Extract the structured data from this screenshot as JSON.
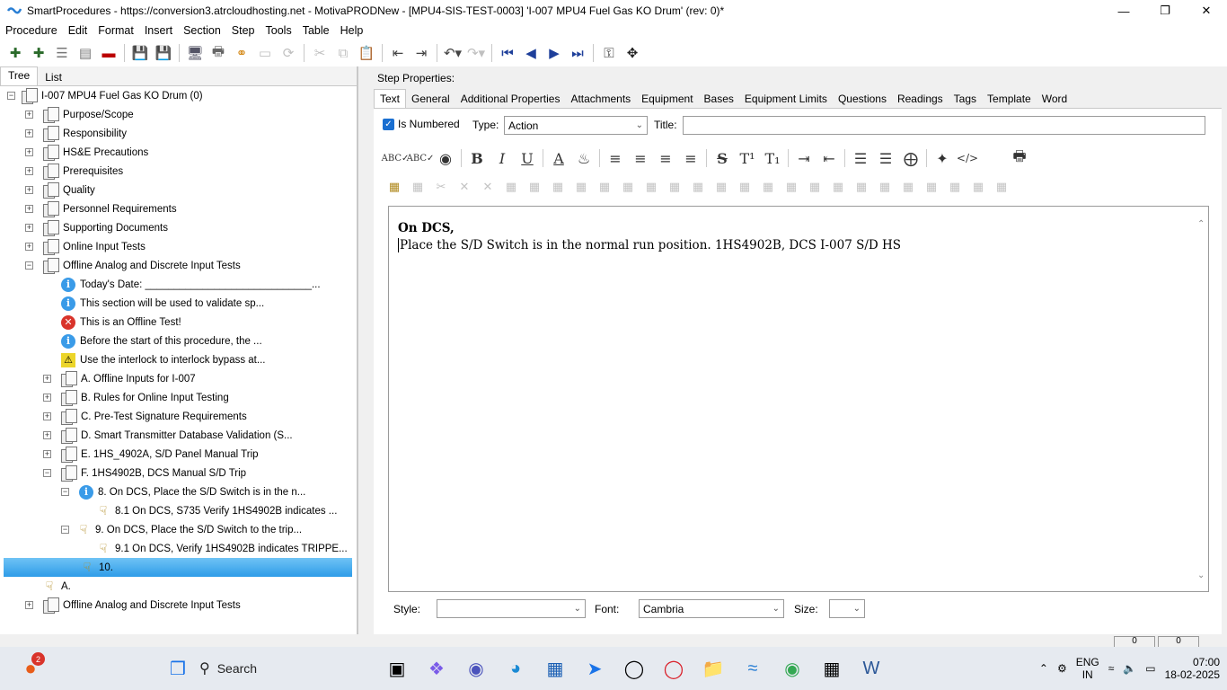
{
  "window": {
    "title": "SmartProcedures - https://conversion3.atrcloudhosting.net - MotivaPRODNew - [MPU4-SIS-TEST-0003] 'I-007 MPU4 Fuel Gas KO Drum' (rev: 0)*",
    "min_icon": "minimize-icon",
    "max_icon": "maximize-icon",
    "close_icon": "close-icon"
  },
  "menu": [
    "Procedure",
    "Edit",
    "Format",
    "Insert",
    "Section",
    "Step",
    "Tools",
    "Table",
    "Help"
  ],
  "left_tabs": [
    "Tree",
    "List"
  ],
  "tree": [
    {
      "label": "I-007 MPU4 Fuel Gas KO Drum (0)",
      "icon": "doc"
    },
    {
      "label": "Purpose/Scope",
      "icon": "doc"
    },
    {
      "label": "Responsibility",
      "icon": "doc"
    },
    {
      "label": "HS&E Precautions",
      "icon": "doc"
    },
    {
      "label": "Prerequisites",
      "icon": "doc"
    },
    {
      "label": "Quality",
      "icon": "doc"
    },
    {
      "label": "Personnel Requirements",
      "icon": "doc"
    },
    {
      "label": "Supporting Documents",
      "icon": "doc"
    },
    {
      "label": "Online Input Tests",
      "icon": "doc"
    },
    {
      "label": "Offline Analog and Discrete Input Tests",
      "icon": "doc"
    },
    {
      "label": "Today's Date: _____________________________...",
      "icon": "info"
    },
    {
      "label": "This section will be used to validate sp...",
      "icon": "info"
    },
    {
      "label": "This is an Offline Test!",
      "icon": "error"
    },
    {
      "label": "Before the start of this procedure, the ...",
      "icon": "info"
    },
    {
      "label": "Use the interlock to interlock bypass at...",
      "icon": "warn"
    },
    {
      "label": "A. Offline Inputs for I-007",
      "icon": "doc"
    },
    {
      "label": "B. Rules for Online Input Testing",
      "icon": "doc"
    },
    {
      "label": "C. Pre-Test Signature Requirements",
      "icon": "doc"
    },
    {
      "label": "D. Smart Transmitter Database Validation (S...",
      "icon": "doc"
    },
    {
      "label": "E. 1HS_4902A, S/D Panel Manual Trip",
      "icon": "doc"
    },
    {
      "label": "F. 1HS4902B, DCS Manual S/D Trip",
      "icon": "doc"
    },
    {
      "label": "8. On DCS, Place the S/D Switch is in the n...",
      "icon": "info"
    },
    {
      "label": "8.1 On DCS, S735 Verify 1HS4902B  indicates ...",
      "icon": "hand"
    },
    {
      "label": "9. On DCS, Place the S/D Switch to the trip...",
      "icon": "hand"
    },
    {
      "label": "9.1 On DCS, Verify 1HS4902B indicates TRIPPE...",
      "icon": "hand"
    },
    {
      "label": "10.",
      "icon": "hand"
    },
    {
      "label": "A.",
      "icon": "hand"
    },
    {
      "label": "Offline Analog and Discrete Input Tests",
      "icon": "doc"
    }
  ],
  "step": {
    "properties_label": "Step Properties:",
    "tabs": [
      "Text",
      "General",
      "Additional Properties",
      "Attachments",
      "Equipment",
      "Bases",
      "Equipment Limits",
      "Questions",
      "Readings",
      "Tags",
      "Template",
      "Word"
    ],
    "is_numbered_label": "Is Numbered",
    "type_label": "Type:",
    "type_value": "Action",
    "title_label": "Title:",
    "title_value": "",
    "text_line1": "On DCS,",
    "text_line2": "Place the S/D Switch is in the normal run position. 1HS4902B, DCS I-007 S/D HS",
    "style_label": "Style:",
    "style_value": "",
    "font_label": "Font:",
    "font_value": "Cambria",
    "size_label": "Size:",
    "size_value": ""
  },
  "statusbar": {
    "box1": "0",
    "box2": "0"
  },
  "taskbar": {
    "search_label": "Search",
    "badge_count": "2",
    "lang": "ENG",
    "region": "IN",
    "time": "07:00",
    "date": "18-02-2025"
  }
}
